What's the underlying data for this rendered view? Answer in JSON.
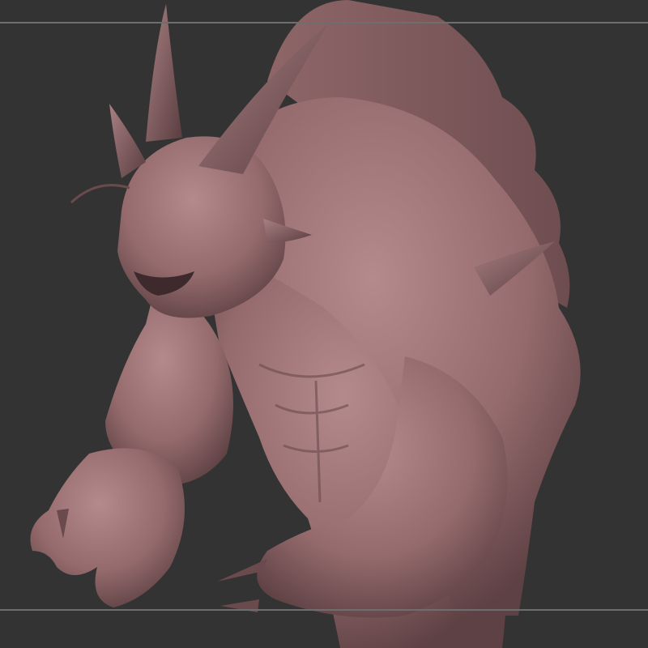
{
  "viewport": {
    "background_color": "#333333",
    "guide_line_color": "#6e6e6e",
    "model": {
      "material_color": "#9a6e70",
      "shadow_color": "#5c3f42",
      "highlight_color": "#b88c8e"
    }
  }
}
